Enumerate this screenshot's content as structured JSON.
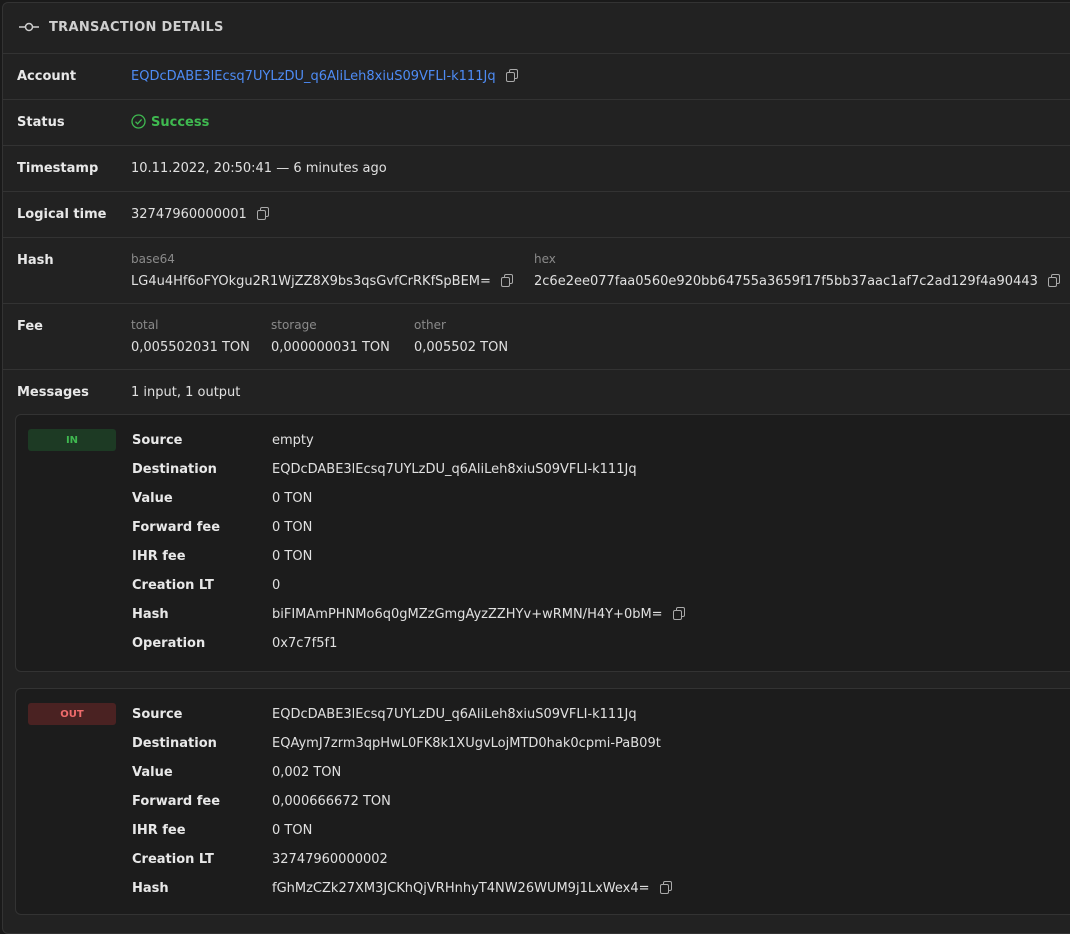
{
  "header": {
    "title": "TRANSACTION DETAILS",
    "icon": "commit-icon"
  },
  "account": {
    "label": "Account",
    "value": "EQDcDABE3lEcsq7UYLzDU_q6AliLeh8xiuS09VFLI-k111Jq"
  },
  "status": {
    "label": "Status",
    "value": "Success"
  },
  "timestamp": {
    "label": "Timestamp",
    "value": "10.11.2022, 20:50:41 — 6 minutes ago"
  },
  "logical_time": {
    "label": "Logical time",
    "value": "32747960000001"
  },
  "hash": {
    "label": "Hash",
    "base64_label": "base64",
    "base64": "LG4u4Hf6oFYOkgu2R1WjZZ8X9bs3qsGvfCrRKfSpBEM=",
    "hex_label": "hex",
    "hex": "2c6e2ee077faa0560e920bb64755a3659f17f5bb37aac1af7c2ad129f4a90443"
  },
  "fee": {
    "label": "Fee",
    "total_label": "total",
    "total": "0,005502031 TON",
    "storage_label": "storage",
    "storage": "0,000000031 TON",
    "other_label": "other",
    "other": "0,005502 TON"
  },
  "messages": {
    "label": "Messages",
    "value": "1 input, 1 output"
  },
  "msg_in": {
    "badge": "IN",
    "source_label": "Source",
    "source": "empty",
    "destination_label": "Destination",
    "destination": "EQDcDABE3lEcsq7UYLzDU_q6AliLeh8xiuS09VFLI-k111Jq",
    "value_label": "Value",
    "value": "0 TON",
    "forward_fee_label": "Forward fee",
    "forward_fee": "0 TON",
    "ihr_fee_label": "IHR fee",
    "ihr_fee": "0 TON",
    "creation_lt_label": "Creation LT",
    "creation_lt": "0",
    "hash_label": "Hash",
    "hash": "biFIMAmPHNMo6q0gMZzGmgAyzZZHYv+wRMN/H4Y+0bM=",
    "operation_label": "Operation",
    "operation": "0x7c7f5f1"
  },
  "msg_out": {
    "badge": "OUT",
    "source_label": "Source",
    "source": "EQDcDABE3lEcsq7UYLzDU_q6AliLeh8xiuS09VFLI-k111Jq",
    "destination_label": "Destination",
    "destination": "EQAymJ7zrm3qpHwL0FK8k1XUgvLojMTD0hak0cpmi-PaB09t",
    "value_label": "Value",
    "value": "0,002 TON",
    "forward_fee_label": "Forward fee",
    "forward_fee": "0,000666672 TON",
    "ihr_fee_label": "IHR fee",
    "ihr_fee": "0 TON",
    "creation_lt_label": "Creation LT",
    "creation_lt": "32747960000002",
    "hash_label": "Hash",
    "hash": "fGhMzCZk27XM3JCKhQjVRHnhyT4NW26WUM9j1LxWex4="
  },
  "colors": {
    "link": "#4e8cf5",
    "success": "#3fb950",
    "in_badge": "#1d3a24",
    "out_badge": "#4a2222"
  }
}
